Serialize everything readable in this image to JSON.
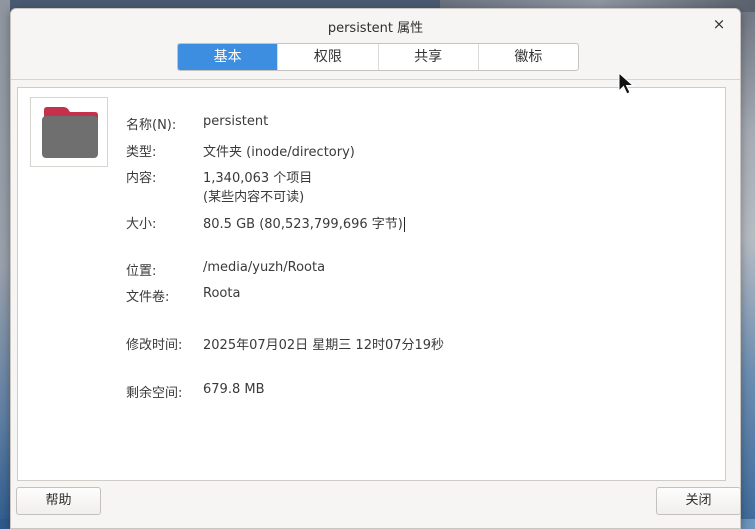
{
  "window": {
    "title": "persistent 属性",
    "close_glyph": "×"
  },
  "tabs": [
    {
      "label": "基本",
      "active": true
    },
    {
      "label": "权限",
      "active": false
    },
    {
      "label": "共享",
      "active": false
    },
    {
      "label": "徽标",
      "active": false
    }
  ],
  "properties": {
    "icon": "folder-icon",
    "name_label": "名称(N):",
    "name_value": "persistent",
    "type_label": "类型:",
    "type_value": "文件夹 (inode/directory)",
    "contents_label": "内容:",
    "contents_value": "1,340,063 个项目",
    "contents_note": "(某些内容不可读)",
    "size_label": "大小:",
    "size_value": "80.5 GB (80,523,799,696 字节)",
    "location_label": "位置:",
    "location_value": "/media/yuzh/Roota",
    "volume_label": "文件卷:",
    "volume_value": "Roota",
    "modified_label": "修改时间:",
    "modified_value": "2025年07月02日 星期三 12时07分19秒",
    "free_space_label": "剩余空间:",
    "free_space_value": "679.8 MB"
  },
  "footer": {
    "help_label": "帮助",
    "close_label": "关闭"
  },
  "colors": {
    "accent": "#3d8ee0",
    "folder_body": "#6f6f6f",
    "folder_tab": "#c3324a"
  }
}
